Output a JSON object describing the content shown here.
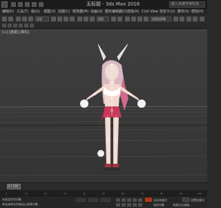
{
  "window": {
    "title": "无标题 - 3ds Max 2016",
    "search_placeholder": "键入关键字或短语"
  },
  "menu": {
    "items": [
      "编辑(E)",
      "工具(T)",
      "组(G)",
      "视图(V)",
      "创建(C)",
      "修改器(M)",
      "动画(A)",
      "图形编辑器(D)",
      "渲染(R)",
      "Civil View",
      "自定义(U)",
      "脚本(S)",
      "帮助(H)"
    ]
  },
  "toolbar": {
    "selection_filter": "全部",
    "view_dropdown": "视图",
    "named_selection": "创建选择集"
  },
  "viewport": {
    "label": "[+] [透视] [真实]"
  },
  "timeline": {
    "frame_indicator": "0 / 100",
    "ticks": [
      "0",
      "10",
      "20",
      "30",
      "40",
      "50",
      "60",
      "70",
      "80",
      "90",
      "100"
    ]
  },
  "status": {
    "selection": "未选定任何对象",
    "prompt": "单击或单击并拖动以选择对象",
    "auto_key": "自动关键点",
    "set_key": "设置关键点",
    "key_filter": "关键点过滤器...",
    "selected": "选定对象"
  },
  "colors": {
    "accent_key": "#b03a14",
    "viewport_bg": "#3b3b3b"
  }
}
